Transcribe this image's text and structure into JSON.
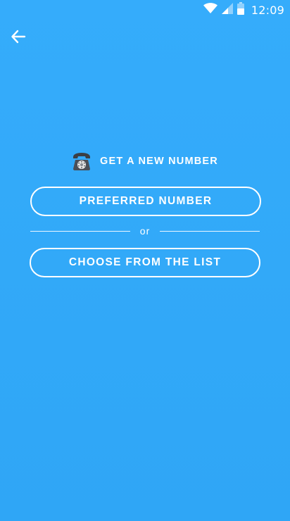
{
  "status_bar": {
    "time": "12:09",
    "icons": [
      "wifi-icon",
      "cell-signal-icon",
      "battery-icon"
    ]
  },
  "header": {
    "back_icon": "arrow-left-icon"
  },
  "main": {
    "heading_icon": "telephone-icon",
    "heading": "GET A NEW NUMBER",
    "preferred_label": "PREFERRED NUMBER",
    "divider_text": "or",
    "choose_label": "CHOOSE FROM THE LIST"
  },
  "colors": {
    "background": "#33aaf9",
    "foreground": "#ffffff"
  }
}
